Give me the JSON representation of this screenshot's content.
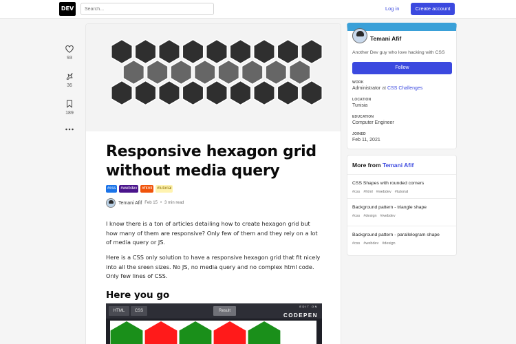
{
  "header": {
    "logo": "DEV",
    "search_placeholder": "Search...",
    "login": "Log in",
    "create_account": "Create account"
  },
  "reactions": {
    "likes": "93",
    "unicorns": "36",
    "bookmarks": "189"
  },
  "article": {
    "title": "Responsive hexagon grid without media query",
    "tags": [
      {
        "label": "#css",
        "bg": "#1a73e8",
        "color": "#ffffff"
      },
      {
        "label": "#webdev",
        "bg": "#4a148c",
        "color": "#ffffff"
      },
      {
        "label": "#html",
        "bg": "#f0530a",
        "color": "#ffffff"
      },
      {
        "label": "#tutorial",
        "bg": "#fff3b0",
        "color": "#8a6d00"
      }
    ],
    "author": "Temani Afif",
    "date": "Feb 15",
    "read_time": "3 min read",
    "paragraph1": "I know there is a ton of articles detailing how to create hexagon grid but how many of them are responsive? Only few of them and they rely on a lot of media query or JS.",
    "paragraph2": "Here is a CSS only solution to have a responsive hexagon grid that fit nicely into all the sreen sizes. No JS, no media query and no complex html code. Only few lines of CSS.",
    "heading": "Here you go",
    "codepen": {
      "tab_html": "HTML",
      "tab_css": "CSS",
      "tab_result": "Result",
      "edit_on": "EDIT ON",
      "brand": "CODEPEN"
    }
  },
  "profile": {
    "name": "Temani Afif",
    "bio": "Another Dev guy who love hacking with CSS",
    "follow": "Follow",
    "work_label": "WORK",
    "work_role": "Administrator",
    "work_at": "at",
    "work_org": "CSS Challenges",
    "location_label": "LOCATION",
    "location": "Tunisia",
    "education_label": "EDUCATION",
    "education": "Computer Engineer",
    "joined_label": "JOINED",
    "joined": "Feb 11, 2021",
    "accent": "#3aa0d8"
  },
  "more_from": {
    "prefix": "More from",
    "author": "Temani Afif",
    "items": [
      {
        "title": "CSS Shapes with rounded corners",
        "tags": [
          "#css",
          "#html",
          "#webdev",
          "#tutorial"
        ]
      },
      {
        "title": "Background pattern - triangle shape",
        "tags": [
          "#css",
          "#design",
          "#webdev"
        ]
      },
      {
        "title": "Background pattern - parallelogram shape",
        "tags": [
          "#css",
          "#webdev",
          "#design"
        ]
      }
    ]
  },
  "colors": {
    "brand": "#3b49df",
    "hex_dark": "#2f2f2f",
    "hex_mid": "#4a4a4a",
    "hex_light": "#666666",
    "pen_green": "#1a8f1a",
    "pen_red": "#ff1a1a"
  }
}
